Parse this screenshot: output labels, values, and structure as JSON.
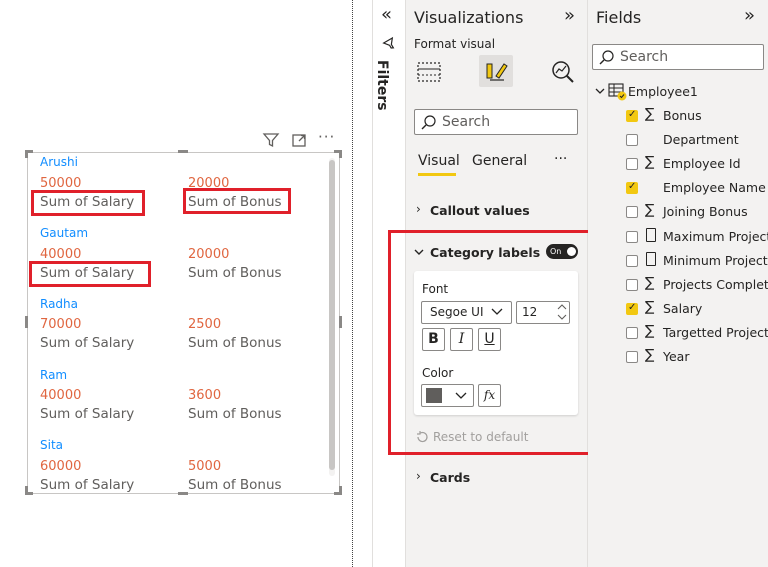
{
  "canvas": {
    "visual_header": {
      "filter_icon": "filter-icon",
      "focus_icon": "focus-mode-icon",
      "more_icon": "more-options-icon",
      "more_glyph": "···"
    },
    "cards": [
      {
        "category": "Arushi",
        "salary_value": "50000",
        "salary_label": "Sum of Salary",
        "bonus_value": "20000",
        "bonus_label": "Sum of Bonus"
      },
      {
        "category": "Gautam",
        "salary_value": "40000",
        "salary_label": "Sum of Salary",
        "bonus_value": "20000",
        "bonus_label": "Sum of Bonus"
      },
      {
        "category": "Radha",
        "salary_value": "70000",
        "salary_label": "Sum of Salary",
        "bonus_value": "2500",
        "bonus_label": "Sum of Bonus"
      },
      {
        "category": "Ram",
        "salary_value": "40000",
        "salary_label": "Sum of Salary",
        "bonus_value": "3600",
        "bonus_label": "Sum of Bonus"
      },
      {
        "category": "Sita",
        "salary_value": "60000",
        "salary_label": "Sum of Salary",
        "bonus_value": "5000",
        "bonus_label": "Sum of Bonus"
      }
    ]
  },
  "filters": {
    "label": "Filters",
    "collapse_glyph": "«"
  },
  "visualizations": {
    "title": "Visualizations",
    "expand_glyph": "»",
    "format_visual": "Format visual",
    "search_placeholder": "Search",
    "tabs": {
      "visual": "Visual",
      "general": "General",
      "more": "···"
    },
    "sections": {
      "callout": "Callout values",
      "category": "Category labels",
      "toggle": "On",
      "cards": "Cards"
    },
    "font": {
      "label": "Font",
      "family": "Segoe UI",
      "size": "12",
      "bold": "B",
      "italic": "I",
      "underline": "U"
    },
    "color": {
      "label": "Color",
      "swatch": "#605e5c",
      "fx": "fx"
    },
    "reset": "Reset to default"
  },
  "fields": {
    "title": "Fields",
    "expand_glyph": "»",
    "search_placeholder": "Search",
    "table": "Employee1",
    "items": [
      {
        "name": "Bonus",
        "checked": true,
        "sigma": true
      },
      {
        "name": "Department",
        "checked": false,
        "sigma": false
      },
      {
        "name": "Employee Id",
        "checked": false,
        "sigma": true
      },
      {
        "name": "Employee Name",
        "checked": true,
        "sigma": false
      },
      {
        "name": "Joining Bonus",
        "checked": false,
        "sigma": true
      },
      {
        "name": "Maximum Projects",
        "checked": false,
        "sigma": false,
        "calc": true
      },
      {
        "name": "Minimum Projects",
        "checked": false,
        "sigma": false,
        "calc": true
      },
      {
        "name": "Projects Complet...",
        "checked": false,
        "sigma": true
      },
      {
        "name": "Salary",
        "checked": true,
        "sigma": true
      },
      {
        "name": "Targetted Projects",
        "checked": false,
        "sigma": true
      },
      {
        "name": "Year",
        "checked": false,
        "sigma": true
      }
    ]
  },
  "colors": {
    "accent_red": "#e0202a",
    "value_orange": "#e06640",
    "category_blue": "#118dff",
    "check_yellow": "#f2c811"
  }
}
